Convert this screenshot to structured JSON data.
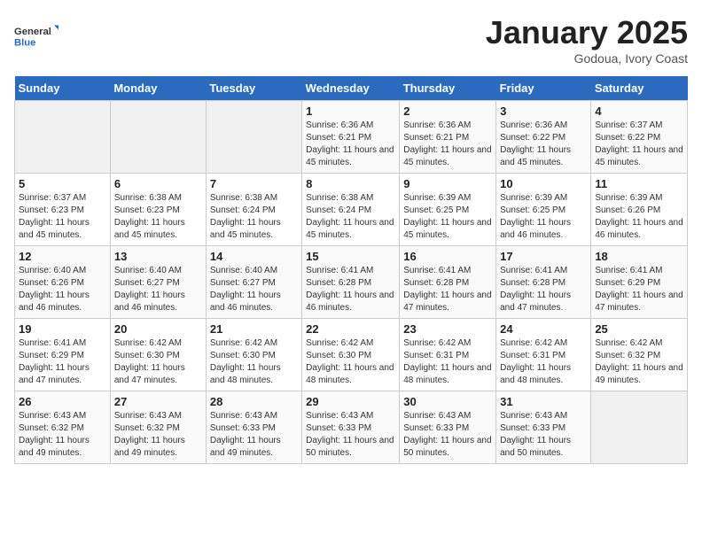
{
  "header": {
    "logo_general": "General",
    "logo_blue": "Blue",
    "month_title": "January 2025",
    "subtitle": "Godoua, Ivory Coast"
  },
  "days_of_week": [
    "Sunday",
    "Monday",
    "Tuesday",
    "Wednesday",
    "Thursday",
    "Friday",
    "Saturday"
  ],
  "weeks": [
    [
      {
        "day": "",
        "info": ""
      },
      {
        "day": "",
        "info": ""
      },
      {
        "day": "",
        "info": ""
      },
      {
        "day": "1",
        "info": "Sunrise: 6:36 AM\nSunset: 6:21 PM\nDaylight: 11 hours and 45 minutes."
      },
      {
        "day": "2",
        "info": "Sunrise: 6:36 AM\nSunset: 6:21 PM\nDaylight: 11 hours and 45 minutes."
      },
      {
        "day": "3",
        "info": "Sunrise: 6:36 AM\nSunset: 6:22 PM\nDaylight: 11 hours and 45 minutes."
      },
      {
        "day": "4",
        "info": "Sunrise: 6:37 AM\nSunset: 6:22 PM\nDaylight: 11 hours and 45 minutes."
      }
    ],
    [
      {
        "day": "5",
        "info": "Sunrise: 6:37 AM\nSunset: 6:23 PM\nDaylight: 11 hours and 45 minutes."
      },
      {
        "day": "6",
        "info": "Sunrise: 6:38 AM\nSunset: 6:23 PM\nDaylight: 11 hours and 45 minutes."
      },
      {
        "day": "7",
        "info": "Sunrise: 6:38 AM\nSunset: 6:24 PM\nDaylight: 11 hours and 45 minutes."
      },
      {
        "day": "8",
        "info": "Sunrise: 6:38 AM\nSunset: 6:24 PM\nDaylight: 11 hours and 45 minutes."
      },
      {
        "day": "9",
        "info": "Sunrise: 6:39 AM\nSunset: 6:25 PM\nDaylight: 11 hours and 45 minutes."
      },
      {
        "day": "10",
        "info": "Sunrise: 6:39 AM\nSunset: 6:25 PM\nDaylight: 11 hours and 46 minutes."
      },
      {
        "day": "11",
        "info": "Sunrise: 6:39 AM\nSunset: 6:26 PM\nDaylight: 11 hours and 46 minutes."
      }
    ],
    [
      {
        "day": "12",
        "info": "Sunrise: 6:40 AM\nSunset: 6:26 PM\nDaylight: 11 hours and 46 minutes."
      },
      {
        "day": "13",
        "info": "Sunrise: 6:40 AM\nSunset: 6:27 PM\nDaylight: 11 hours and 46 minutes."
      },
      {
        "day": "14",
        "info": "Sunrise: 6:40 AM\nSunset: 6:27 PM\nDaylight: 11 hours and 46 minutes."
      },
      {
        "day": "15",
        "info": "Sunrise: 6:41 AM\nSunset: 6:28 PM\nDaylight: 11 hours and 46 minutes."
      },
      {
        "day": "16",
        "info": "Sunrise: 6:41 AM\nSunset: 6:28 PM\nDaylight: 11 hours and 47 minutes."
      },
      {
        "day": "17",
        "info": "Sunrise: 6:41 AM\nSunset: 6:28 PM\nDaylight: 11 hours and 47 minutes."
      },
      {
        "day": "18",
        "info": "Sunrise: 6:41 AM\nSunset: 6:29 PM\nDaylight: 11 hours and 47 minutes."
      }
    ],
    [
      {
        "day": "19",
        "info": "Sunrise: 6:41 AM\nSunset: 6:29 PM\nDaylight: 11 hours and 47 minutes."
      },
      {
        "day": "20",
        "info": "Sunrise: 6:42 AM\nSunset: 6:30 PM\nDaylight: 11 hours and 47 minutes."
      },
      {
        "day": "21",
        "info": "Sunrise: 6:42 AM\nSunset: 6:30 PM\nDaylight: 11 hours and 48 minutes."
      },
      {
        "day": "22",
        "info": "Sunrise: 6:42 AM\nSunset: 6:30 PM\nDaylight: 11 hours and 48 minutes."
      },
      {
        "day": "23",
        "info": "Sunrise: 6:42 AM\nSunset: 6:31 PM\nDaylight: 11 hours and 48 minutes."
      },
      {
        "day": "24",
        "info": "Sunrise: 6:42 AM\nSunset: 6:31 PM\nDaylight: 11 hours and 48 minutes."
      },
      {
        "day": "25",
        "info": "Sunrise: 6:42 AM\nSunset: 6:32 PM\nDaylight: 11 hours and 49 minutes."
      }
    ],
    [
      {
        "day": "26",
        "info": "Sunrise: 6:43 AM\nSunset: 6:32 PM\nDaylight: 11 hours and 49 minutes."
      },
      {
        "day": "27",
        "info": "Sunrise: 6:43 AM\nSunset: 6:32 PM\nDaylight: 11 hours and 49 minutes."
      },
      {
        "day": "28",
        "info": "Sunrise: 6:43 AM\nSunset: 6:33 PM\nDaylight: 11 hours and 49 minutes."
      },
      {
        "day": "29",
        "info": "Sunrise: 6:43 AM\nSunset: 6:33 PM\nDaylight: 11 hours and 50 minutes."
      },
      {
        "day": "30",
        "info": "Sunrise: 6:43 AM\nSunset: 6:33 PM\nDaylight: 11 hours and 50 minutes."
      },
      {
        "day": "31",
        "info": "Sunrise: 6:43 AM\nSunset: 6:33 PM\nDaylight: 11 hours and 50 minutes."
      },
      {
        "day": "",
        "info": ""
      }
    ]
  ],
  "accent_color": "#2a6bbf"
}
